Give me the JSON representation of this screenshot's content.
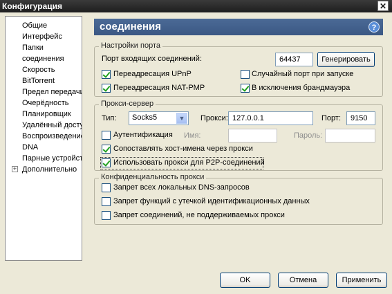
{
  "window": {
    "title": "Конфигурация",
    "close_glyph": "✕"
  },
  "sidebar": {
    "items": [
      {
        "label": "Общие"
      },
      {
        "label": "Интерфейс"
      },
      {
        "label": "Папки"
      },
      {
        "label": "соединения"
      },
      {
        "label": "Скорость"
      },
      {
        "label": "BitTorrent"
      },
      {
        "label": "Предел передачи"
      },
      {
        "label": "Очерёдность"
      },
      {
        "label": "Планировщик"
      },
      {
        "label": "Удалённый доступ"
      },
      {
        "label": "Воспроизведение"
      },
      {
        "label": "DNA"
      },
      {
        "label": "Парные устройства"
      },
      {
        "label": "Дополнительно",
        "expander": "+"
      }
    ]
  },
  "header": {
    "title": "соединения",
    "help_glyph": "?"
  },
  "port_settings": {
    "title": "Настройки порта",
    "incoming_label": "Порт входящих соединений:",
    "port_value": "64437",
    "generate_label": "Генерировать",
    "upnp": {
      "label": "Переадресация UPnP",
      "checked": true
    },
    "random_port": {
      "label": "Случайный порт при запуске",
      "checked": false
    },
    "natpmp": {
      "label": "Переадресация NAT-PMP",
      "checked": true
    },
    "firewall": {
      "label": "В исключения брандмауэра",
      "checked": true
    }
  },
  "proxy": {
    "title": "Прокси-сервер",
    "type_label": "Тип:",
    "type_value": "Socks5",
    "proxy_label": "Прокси:",
    "proxy_value": "127.0.0.1",
    "port_label": "Порт:",
    "port_value": "9150",
    "auth": {
      "label": "Аутентификация",
      "checked": false
    },
    "name_label": "Имя:",
    "password_label": "Пароль:",
    "resolve_hostnames": {
      "label": "Сопоставлять хост-имена через прокси",
      "checked": true
    },
    "use_for_p2p": {
      "label": "Использовать прокси для P2P-соединений",
      "checked": true
    }
  },
  "privacy": {
    "title": "Конфиденциальность прокси",
    "block_dns": {
      "label": "Запрет всех локальных DNS-запросов",
      "checked": false
    },
    "block_leak": {
      "label": "Запрет функций с утечкой идентификационных данных",
      "checked": false
    },
    "block_unsupported": {
      "label": "Запрет соединений, не поддерживаемых прокси",
      "checked": false
    }
  },
  "footer": {
    "ok": "OK",
    "cancel": "Отмена",
    "apply": "Применить"
  }
}
